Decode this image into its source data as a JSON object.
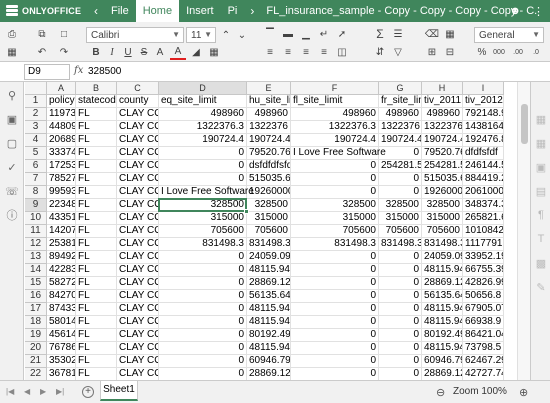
{
  "app": {
    "brand": "ONLYOFFICE",
    "doc_title": "FL_insurance_sample - Copy - Copy - Copy - Copy - C...",
    "menu_tabs": [
      {
        "label": "File",
        "active": false
      },
      {
        "label": "Home",
        "active": true
      },
      {
        "label": "Insert",
        "active": false
      },
      {
        "label": "Pi",
        "active": false
      }
    ]
  },
  "toolbar": {
    "font_name": "Calibri",
    "font_size": "11",
    "number_format": "General",
    "bold": "B",
    "italic": "I",
    "underline": "U",
    "strike": "S",
    "superscript": "A",
    "font_color": "A",
    "sigma": "Σ",
    "percent": "%",
    "thousands": "000",
    "dec_inc": ".00",
    "dec_dec": ".0"
  },
  "formula_bar": {
    "cell_ref": "D9",
    "fx": "fx",
    "value": "328500"
  },
  "columns": [
    "A",
    "B",
    "C",
    "D",
    "E",
    "F",
    "G",
    "H",
    "I"
  ],
  "rows": [
    {
      "n": "1",
      "cells": [
        "policyID",
        "statecode",
        "county",
        "eq_site_limit",
        "hu_site_lir",
        "fl_site_limit",
        "fr_site_lim",
        "tiv_2011",
        "tiv_2012"
      ]
    },
    {
      "n": "2",
      "cells": [
        "119736",
        "FL",
        "CLAY COUI",
        "498960",
        "498960",
        "498960",
        "498960",
        "498960",
        "792148.9"
      ]
    },
    {
      "n": "3",
      "cells": [
        "448094",
        "FL",
        "CLAY COUI",
        "1322376.3",
        "1322376",
        "1322376.3",
        "1322376",
        "1322376",
        "1438164"
      ]
    },
    {
      "n": "4",
      "cells": [
        "206893",
        "FL",
        "CLAY COUI",
        "190724.4",
        "190724.4",
        "190724.4",
        "190724.4",
        "190724.4",
        "192476.8"
      ]
    },
    {
      "n": "5",
      "cells": [
        "333743",
        "FL",
        "CLAY COUI",
        "0",
        "79520.76",
        "I Love Free Software",
        "",
        "0",
        "79520.76",
        "dfdfsfdf"
      ]
    },
    {
      "n": "6",
      "cells": [
        "172534",
        "FL",
        "CLAY COUI",
        "0",
        "dsfdfdfsfdf",
        "0",
        "254281.5",
        "254281.5",
        "246144.5"
      ]
    },
    {
      "n": "7",
      "cells": [
        "785275",
        "FL",
        "CLAY COUI",
        "0",
        "515035.6",
        "0",
        "0",
        "515035.6",
        "884419.2"
      ]
    },
    {
      "n": "8",
      "cells": [
        "995932",
        "FL",
        "CLAY COUI",
        "I Love Free Software",
        "19260000",
        "0",
        "0",
        "19260000",
        "20610000"
      ]
    },
    {
      "n": "9",
      "cells": [
        "223488",
        "FL",
        "CLAY COUI",
        "328500",
        "328500",
        "328500",
        "328500",
        "328500",
        "348374.3"
      ]
    },
    {
      "n": "10",
      "cells": [
        "433512",
        "FL",
        "CLAY COUI",
        "315000",
        "315000",
        "315000",
        "315000",
        "315000",
        "265821.6"
      ]
    },
    {
      "n": "11",
      "cells": [
        "142071",
        "FL",
        "CLAY COUI",
        "705600",
        "705600",
        "705600",
        "705600",
        "705600",
        "1010842"
      ]
    },
    {
      "n": "12",
      "cells": [
        "253816",
        "FL",
        "CLAY COUI",
        "831498.3",
        "831498.3",
        "831498.3",
        "831498.3",
        "831498.3",
        "1117791"
      ]
    },
    {
      "n": "13",
      "cells": [
        "894922",
        "FL",
        "CLAY COUI",
        "0",
        "24059.09",
        "0",
        "0",
        "24059.09",
        "33952.19"
      ]
    },
    {
      "n": "14",
      "cells": [
        "422834",
        "FL",
        "CLAY COUI",
        "0",
        "48115.94",
        "0",
        "0",
        "48115.94",
        "66755.39"
      ]
    },
    {
      "n": "15",
      "cells": [
        "582721",
        "FL",
        "CLAY COUI",
        "0",
        "28869.12",
        "0",
        "0",
        "28869.12",
        "42826.99"
      ]
    },
    {
      "n": "16",
      "cells": [
        "842700",
        "FL",
        "CLAY COUI",
        "0",
        "56135.64",
        "0",
        "0",
        "56135.64",
        "50656.8"
      ]
    },
    {
      "n": "17",
      "cells": [
        "874333",
        "FL",
        "CLAY COUI",
        "0",
        "48115.94",
        "0",
        "0",
        "48115.94",
        "67905.07"
      ]
    },
    {
      "n": "18",
      "cells": [
        "580146",
        "FL",
        "CLAY COUI",
        "0",
        "48115.94",
        "0",
        "0",
        "48115.94",
        "66938.9"
      ]
    },
    {
      "n": "19",
      "cells": [
        "456149",
        "FL",
        "CLAY COUI",
        "0",
        "80192.49",
        "0",
        "0",
        "80192.49",
        "86421.04"
      ]
    },
    {
      "n": "20",
      "cells": [
        "767862",
        "FL",
        "CLAY COUI",
        "0",
        "48115.94",
        "0",
        "0",
        "48115.94",
        "73798.5"
      ]
    },
    {
      "n": "21",
      "cells": [
        "353022",
        "FL",
        "CLAY COUI",
        "0",
        "60946.79",
        "0",
        "0",
        "60946.79",
        "62467.29"
      ]
    },
    {
      "n": "22",
      "cells": [
        "367814",
        "FL",
        "CLAY COUI",
        "0",
        "28869.12",
        "0",
        "0",
        "28869.12",
        "42727.74"
      ]
    }
  ],
  "status": {
    "sheet_name": "Sheet1",
    "zoom": "Zoom 100%"
  },
  "colors": {
    "accent": "#40865c",
    "header_bg": "#f4f4f4",
    "toolbar_bg": "#f1f1f1"
  }
}
